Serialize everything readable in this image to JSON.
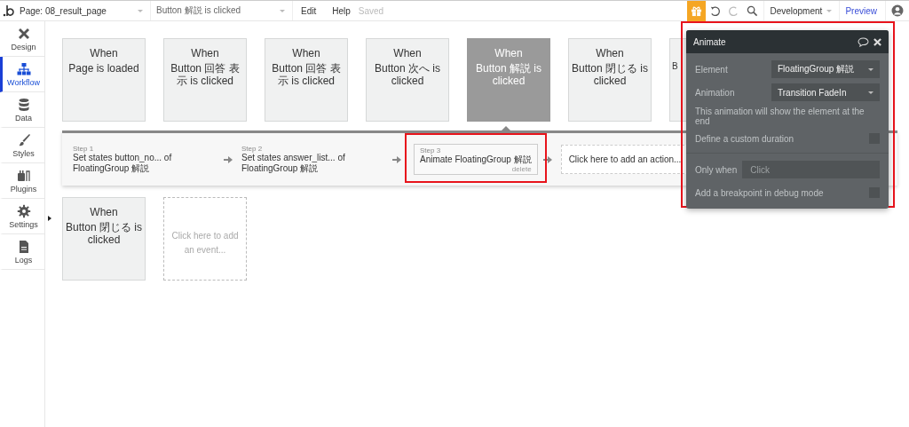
{
  "top_bar": {
    "page_selector": "Page: 08_result_page",
    "event_selector": "Button 解説 is clicked",
    "menu": [
      "Edit",
      "Help"
    ],
    "status": "Saved",
    "environment": "Development",
    "preview": "Preview"
  },
  "sidebar": {
    "items": [
      {
        "kind": "design",
        "label": "Design",
        "selected": false
      },
      {
        "kind": "workflow",
        "label": "Workflow",
        "selected": true
      },
      {
        "kind": "data",
        "label": "Data",
        "selected": false
      },
      {
        "kind": "styles",
        "label": "Styles",
        "selected": false
      },
      {
        "kind": "plugins",
        "label": "Plugins",
        "selected": false
      },
      {
        "kind": "settings",
        "label": "Settings",
        "selected": false
      },
      {
        "kind": "logs",
        "label": "Logs",
        "selected": false
      }
    ]
  },
  "events": [
    {
      "kind": "event",
      "title": "When",
      "description": "Page is loaded",
      "selected": false
    },
    {
      "kind": "event",
      "title": "When",
      "description": "Button 回答 表示 is clicked",
      "selected": false
    },
    {
      "kind": "event",
      "title": "When",
      "description": "Button 回答 表示 is clicked",
      "selected": false
    },
    {
      "kind": "event",
      "title": "When",
      "description": "Button 次へ is clicked",
      "selected": false
    },
    {
      "kind": "event",
      "title": "When",
      "description": "Button 解説 is clicked",
      "selected": true
    },
    {
      "kind": "event",
      "title": "When",
      "description": "Button 閉じる is clicked",
      "selected": false
    },
    {
      "kind": "partial",
      "description": "B",
      "selected": false
    }
  ],
  "actions": [
    {
      "step": "Step 1",
      "text": "Set states button_no... of FloatingGroup 解説",
      "selected": false
    },
    {
      "step": "Step 2",
      "text": "Set states answer_list... of FloatingGroup 解説",
      "selected": false
    },
    {
      "step": "Step 3",
      "text": "Animate FloatingGroup 解説",
      "delete": "delete",
      "selected": true
    }
  ],
  "add_action": "Click here to add an action...",
  "events_row2": [
    {
      "kind": "event",
      "title": "When",
      "description": "Button 閉じる is clicked",
      "selected": false
    }
  ],
  "add_event": "Click here to add an event...",
  "panel": {
    "title": "Animate",
    "fields": [
      {
        "kind": "dropdown",
        "label": "Element",
        "value": "FloatingGroup 解説"
      },
      {
        "kind": "dropdown",
        "label": "Animation",
        "value": "Transition FadeIn"
      },
      {
        "kind": "note",
        "text": "This animation will show the element at the end"
      },
      {
        "kind": "checkbox",
        "label": "Define a custom duration",
        "checked": false
      },
      {
        "kind": "condition",
        "label": "Only when",
        "placeholder": "Click"
      },
      {
        "kind": "checkbox",
        "label": "Add a breakpoint in debug mode",
        "checked": false
      }
    ]
  }
}
